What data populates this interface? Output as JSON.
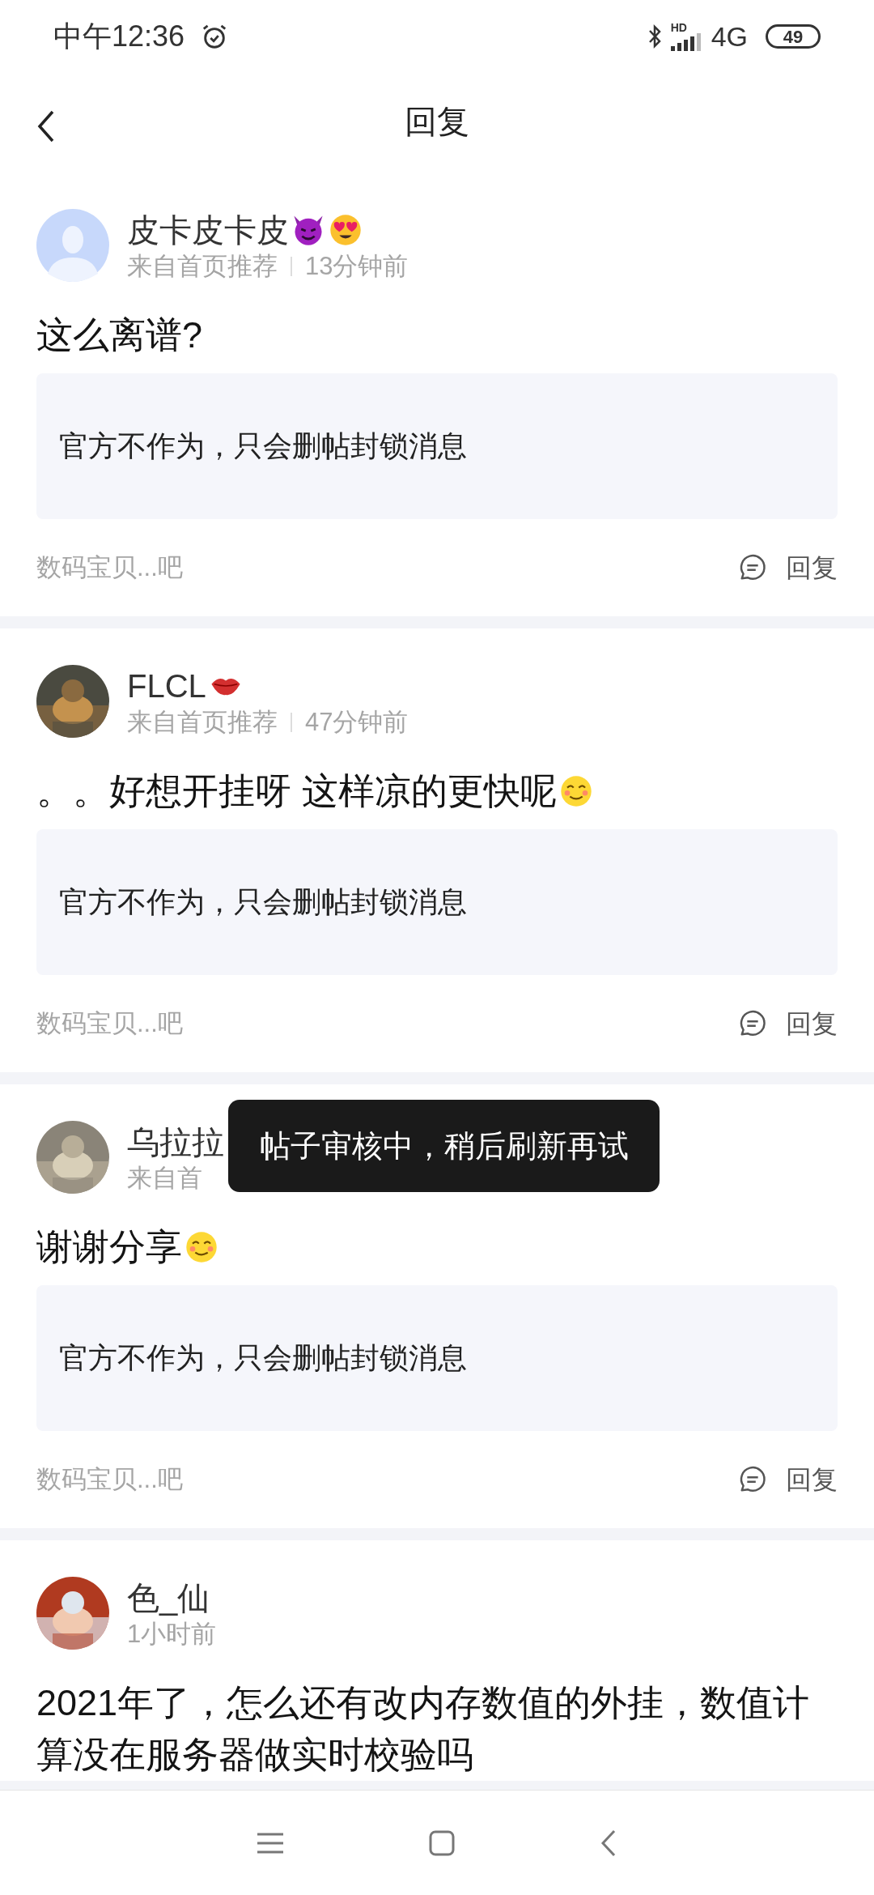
{
  "status_bar": {
    "time": "中午12:36",
    "hd": "HD",
    "network": "4G",
    "battery": "49"
  },
  "header": {
    "title": "回复"
  },
  "posts": [
    {
      "user": "皮卡皮卡皮",
      "source": "来自首页推荐",
      "time": "13分钟前",
      "content": "这么离谱?",
      "quote": "官方不作为，只会删帖封锁消息",
      "forum": "数码宝贝...吧",
      "reply": "回复"
    },
    {
      "user": "FLCL",
      "source": "来自首页推荐",
      "time": "47分钟前",
      "content": "。。好想开挂呀 这样凉的更快呢",
      "quote": "官方不作为，只会删帖封锁消息",
      "forum": "数码宝贝...吧",
      "reply": "回复"
    },
    {
      "user": "乌拉拉",
      "source": "来自首",
      "content": "谢谢分享",
      "quote": "官方不作为，只会删帖封锁消息",
      "forum": "数码宝贝...吧",
      "reply": "回复"
    },
    {
      "user": "色_仙",
      "time": "1小时前",
      "content": "2021年了，怎么还有改内存数值的外挂，数值计算没在服务器做实时校验吗"
    }
  ],
  "toast": "帖子审核中，稍后刷新再试"
}
